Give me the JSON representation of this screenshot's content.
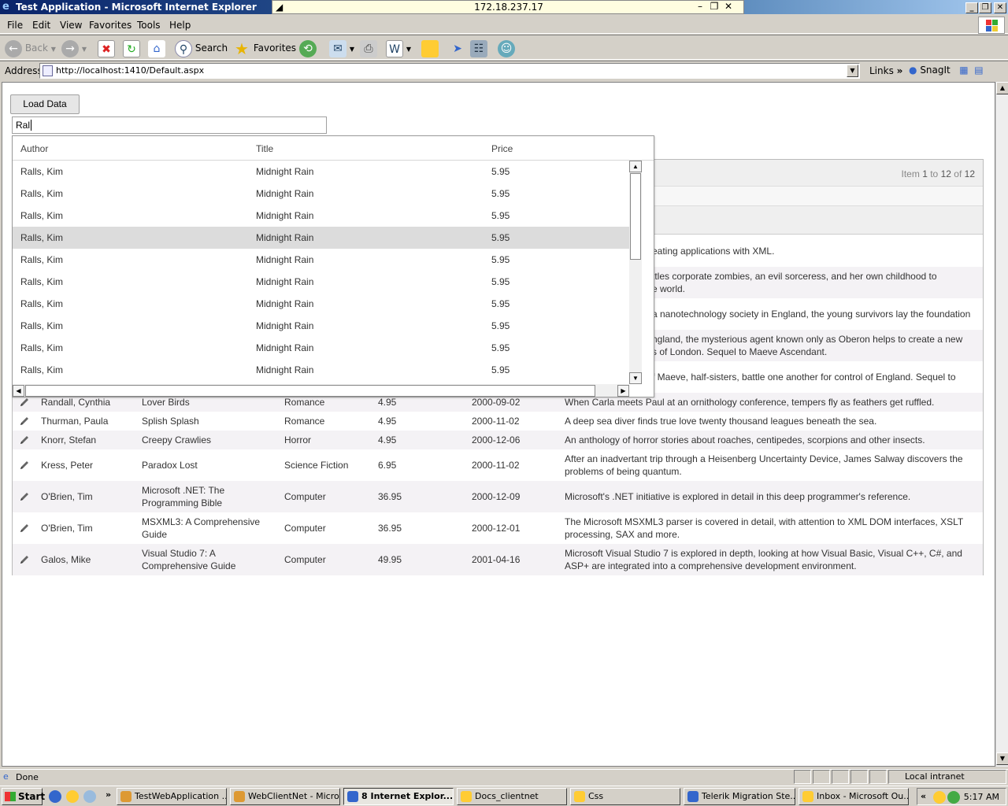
{
  "window": {
    "title": "Test Application - Microsoft Internet Explorer",
    "remote_host": "172.18.237.17"
  },
  "menubar": [
    "File",
    "Edit",
    "View",
    "Favorites",
    "Tools",
    "Help"
  ],
  "toolbar": {
    "back_label": "Back",
    "search_label": "Search",
    "favorites_label": "Favorites"
  },
  "address": {
    "label": "Address",
    "url": "http://localhost:1410/Default.aspx",
    "links_label": "Links",
    "snagit_label": "SnagIt"
  },
  "page": {
    "load_button": "Load Data",
    "search_value": "Ral",
    "pager": {
      "prefix": "Item",
      "from": "1",
      "to_word": "to",
      "to": "12",
      "of_word": "of",
      "total": "12"
    },
    "dropdown": {
      "columns": [
        "Author",
        "Title",
        "Price"
      ],
      "rows": [
        [
          "Ralls, Kim",
          "Midnight Rain",
          "5.95"
        ],
        [
          "Ralls, Kim",
          "Midnight Rain",
          "5.95"
        ],
        [
          "Ralls, Kim",
          "Midnight Rain",
          "5.95"
        ],
        [
          "Ralls, Kim",
          "Midnight Rain",
          "5.95"
        ],
        [
          "Ralls, Kim",
          "Midnight Rain",
          "5.95"
        ],
        [
          "Ralls, Kim",
          "Midnight Rain",
          "5.95"
        ],
        [
          "Ralls, Kim",
          "Midnight Rain",
          "5.95"
        ],
        [
          "Ralls, Kim",
          "Midnight Rain",
          "5.95"
        ],
        [
          "Ralls, Kim",
          "Midnight Rain",
          "5.95"
        ],
        [
          "Ralls, Kim",
          "Midnight Rain",
          "5.95"
        ]
      ],
      "selected_index": 3
    },
    "grid_partial_rows": [
      [
        "eating applications with XML."
      ],
      [
        "ttles corporate zombies, an evil sorceress, and her own childhood to",
        "e world."
      ],
      [
        "a nanotechnology society in England, the young survivors lay the foundation"
      ],
      [
        "ngland, the mysterious agent known only as Oberon helps to create a new",
        "s of London. Sequel to Maeve Ascendant."
      ],
      [
        "f Maeve, half-sisters, battle one another for control of England. Sequel to"
      ]
    ],
    "grid_rows": [
      {
        "author": "Randall, Cynthia",
        "title": [
          "Lover Birds"
        ],
        "genre": "Romance",
        "price": "4.95",
        "date": "2000-09-02",
        "desc": [
          "When Carla meets Paul at an ornithology conference, tempers fly as feathers get ruffled."
        ]
      },
      {
        "author": "Thurman, Paula",
        "title": [
          "Splish Splash"
        ],
        "genre": "Romance",
        "price": "4.95",
        "date": "2000-11-02",
        "desc": [
          "A deep sea diver finds true love twenty thousand leagues beneath the sea."
        ]
      },
      {
        "author": "Knorr, Stefan",
        "title": [
          "Creepy Crawlies"
        ],
        "genre": "Horror",
        "price": "4.95",
        "date": "2000-12-06",
        "desc": [
          "An anthology of horror stories about roaches, centipedes, scorpions and other insects."
        ]
      },
      {
        "author": "Kress, Peter",
        "title": [
          "Paradox Lost"
        ],
        "genre": "Science Fiction",
        "price": "6.95",
        "date": "2000-11-02",
        "desc": [
          "After an inadvertant trip through a Heisenberg Uncertainty Device, James Salway discovers the",
          "problems of being quantum."
        ]
      },
      {
        "author": "O'Brien, Tim",
        "title": [
          "Microsoft .NET: The",
          "Programming Bible"
        ],
        "genre": "Computer",
        "price": "36.95",
        "date": "2000-12-09",
        "desc": [
          "Microsoft's .NET initiative is explored in detail in this deep programmer's reference."
        ]
      },
      {
        "author": "O'Brien, Tim",
        "title": [
          "MSXML3: A Comprehensive",
          "Guide"
        ],
        "genre": "Computer",
        "price": "36.95",
        "date": "2000-12-01",
        "desc": [
          "The Microsoft MSXML3 parser is covered in detail, with attention to XML DOM interfaces, XSLT",
          "processing, SAX and more."
        ]
      },
      {
        "author": "Galos, Mike",
        "title": [
          "Visual Studio 7: A",
          "Comprehensive Guide"
        ],
        "genre": "Computer",
        "price": "49.95",
        "date": "2001-04-16",
        "desc": [
          "Microsoft Visual Studio 7 is explored in depth, looking at how Visual Basic, Visual C++, C#, and",
          "ASP+ are integrated into a comprehensive development environment."
        ]
      }
    ]
  },
  "status": {
    "text": "Done",
    "zone": "Local intranet"
  },
  "taskbar": {
    "start_label": "Start",
    "tasks": [
      {
        "label": "TestWebApplication ...",
        "active": false
      },
      {
        "label": "WebClientNet - Micro...",
        "active": false
      },
      {
        "label": "8 Internet Explor...",
        "active": true
      },
      {
        "label": "Docs_clientnet",
        "active": false
      },
      {
        "label": "Css",
        "active": false
      },
      {
        "label": "Telerik Migration Ste...",
        "active": false
      },
      {
        "label": "Inbox - Microsoft Ou...",
        "active": false
      }
    ],
    "clock": "5:17 AM"
  },
  "colors": {
    "titlebar_start": "#0a246a",
    "chrome": "#d4d0c8",
    "selected_row": "#dcdcdc",
    "alt_row": "#f4f2f5"
  }
}
